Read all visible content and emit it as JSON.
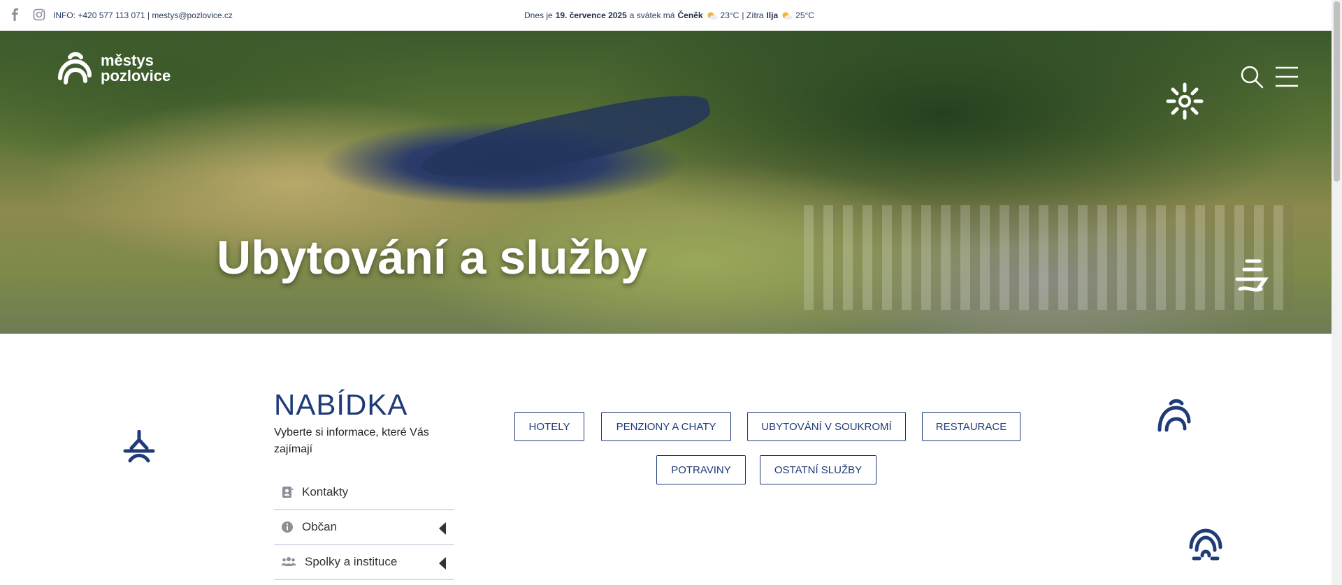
{
  "topbar": {
    "info": "INFO: +420 577 113 071 | mestys@pozlovice.cz",
    "date_prefix": "Dnes je",
    "date": "19. července 2025",
    "svatek_prefix": "a svátek má",
    "svatek": "Čeněk",
    "temp_today": "23°C",
    "tomorrow_prefix": "| Zítra",
    "tomorrow": "Ilja",
    "temp_tomorrow": "25°C"
  },
  "logo": {
    "line1": "městys",
    "line2": "pozlovice"
  },
  "hero": {
    "title": "Ubytování a služby"
  },
  "section": {
    "heading": "NABÍDKA",
    "subtitle": "Vyberte si informace, které Vás zajímají"
  },
  "menu": {
    "items": [
      {
        "label": "Kontakty",
        "icon": "contact-card-icon",
        "has_arrow": false
      },
      {
        "label": "Občan",
        "icon": "info-icon",
        "has_arrow": true
      },
      {
        "label": "Spolky a instituce",
        "icon": "people-icon",
        "has_arrow": true
      }
    ]
  },
  "buttons": {
    "hotely": "HOTELY",
    "penziony": "PENZIONY A CHATY",
    "soukromi": "UBYTOVÁNÍ V SOUKROMÍ",
    "restaurace": "RESTAURACE",
    "potraviny": "POTRAVINY",
    "ostatni": "OSTATNÍ SLUŽBY"
  },
  "colors": {
    "accent": "#1f3b78",
    "text": "#222222",
    "divider": "#d8dde8"
  }
}
